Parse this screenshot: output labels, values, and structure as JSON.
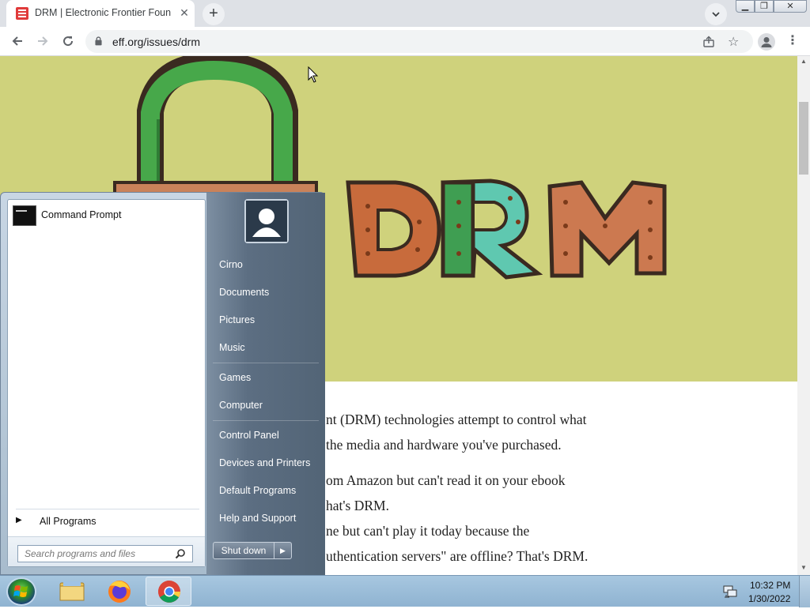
{
  "browser": {
    "tab_title": "DRM | Electronic Frontier Foundation",
    "url": "eff.org/issues/drm"
  },
  "page": {
    "hero_word": "DRM",
    "paragraph_lines": [
      "nt (DRM) technologies attempt to control what",
      " the media and hardware you've purchased.",
      "om Amazon but can't read it on your ebook",
      "hat's DRM.",
      "ne but can't play it today because the",
      "uthentication servers\" are offline? That's DRM."
    ]
  },
  "start_menu": {
    "pinned": [
      {
        "label": "Command Prompt",
        "icon": "command-prompt-icon"
      }
    ],
    "all_programs": "All Programs",
    "search_placeholder": "Search programs and files",
    "right_links": [
      "Cirno",
      "Documents",
      "Pictures",
      "Music",
      "Games",
      "Computer",
      "Control Panel",
      "Devices and Printers",
      "Default Programs",
      "Help and Support"
    ],
    "shutdown_label": "Shut down"
  },
  "taskbar": {
    "apps": [
      "windows-explorer",
      "firefox",
      "chrome"
    ],
    "clock_time": "10:32 PM",
    "clock_date": "1/30/2022"
  }
}
